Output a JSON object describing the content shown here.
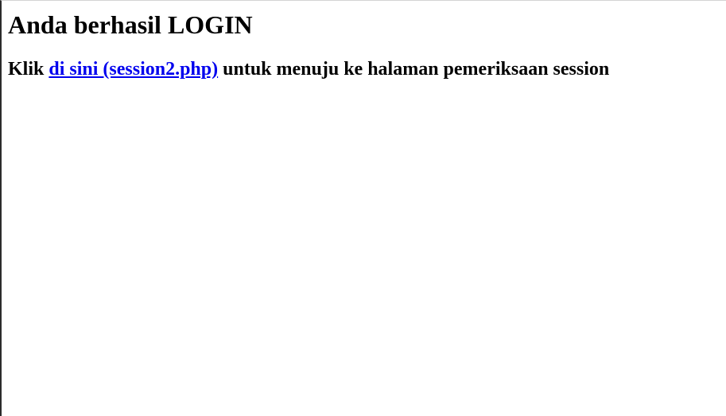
{
  "page": {
    "title": "Anda berhasil LOGIN",
    "instruction_prefix": "Klik ",
    "link_text": "di sini (session2.php)",
    "link_color": "#0000ee",
    "instruction_suffix": " untuk menuju ke halaman pemeriksaan session"
  }
}
